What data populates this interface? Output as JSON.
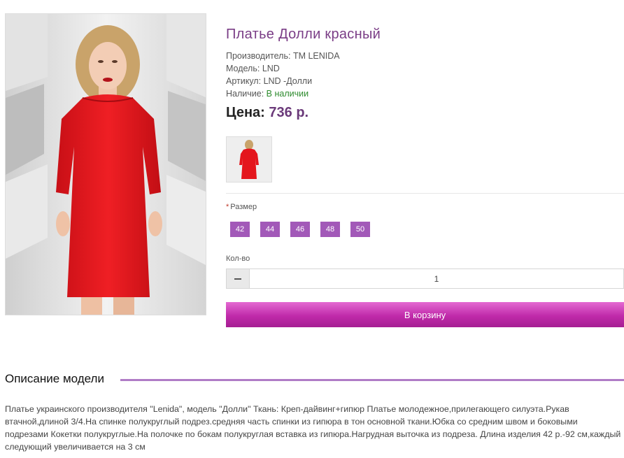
{
  "product": {
    "title": "Платье Долли красный",
    "manufacturer_label": "Производитель:",
    "manufacturer_value": "TM LENIDA",
    "model_label": "Модель:",
    "model_value": "LND",
    "article_label": "Артикул:",
    "article_value": "LND -Долли",
    "availability_label": "Наличие:",
    "availability_value": "В наличии",
    "price_label": "Цена:",
    "price_value": "736 р."
  },
  "options": {
    "size_required_mark": "*",
    "size_label": "Размер",
    "sizes": [
      "42",
      "44",
      "46",
      "48",
      "50"
    ]
  },
  "quantity": {
    "label": "Кол-во",
    "value": "1"
  },
  "cart": {
    "button_label": "В корзину"
  },
  "description": {
    "heading": "Описание модели",
    "text": "Платье украинского производителя \"Lenida\", модель \"Долли\" Ткань: Креп-дайвинг+гипюр Платье молодежное,прилегающего силуэта.Рукав втачной,длиной 3/4.На спинке полукруглый подрез.средняя часть спинки из гипюра в тон основной ткани.Юбка со средним швом и боковыми подрезами Кокетки полукруглые.На полочке по бокам полукруглая вставка из гипюра.Нагрудная выточка из подреза. Длина изделия 42 р.-92 см,каждый следующий увеличивается на 3 см"
  },
  "colors": {
    "accent": "#a259b8",
    "title": "#7a3d86",
    "stock": "#2e8b2e",
    "cart_button": "#c02aaa",
    "dress": "#e4161d"
  }
}
